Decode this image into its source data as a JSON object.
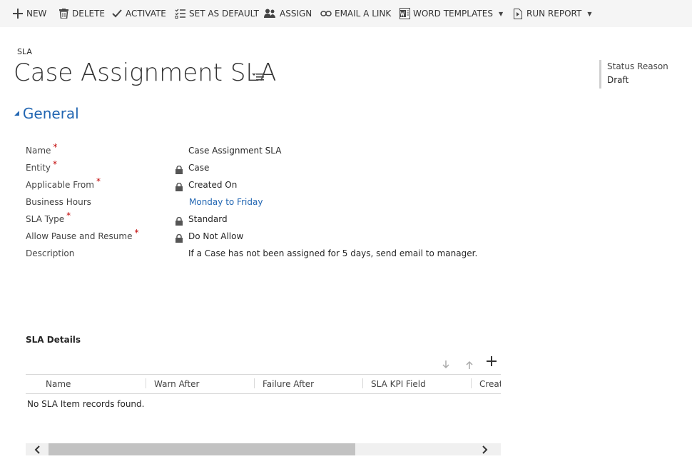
{
  "toolbar": {
    "new": "NEW",
    "delete": "DELETE",
    "activate": "ACTIVATE",
    "set_default": "SET AS DEFAULT",
    "assign": "ASSIGN",
    "email_link": "EMAIL A LINK",
    "word_templates": "WORD TEMPLATES",
    "run_report": "RUN REPORT"
  },
  "header": {
    "entity": "SLA",
    "title": "Case Assignment SLA"
  },
  "status": {
    "label": "Status Reason",
    "value": "Draft"
  },
  "section": {
    "title": "General"
  },
  "fields": {
    "name": {
      "label": "Name",
      "value": "Case Assignment SLA",
      "required": "*"
    },
    "entity": {
      "label": "Entity",
      "value": "Case",
      "required": "*"
    },
    "applicable_from": {
      "label": "Applicable From",
      "value": "Created On",
      "required": "*"
    },
    "business_hours": {
      "label": "Business Hours",
      "value": "Monday to Friday"
    },
    "sla_type": {
      "label": "SLA Type",
      "value": "Standard",
      "required": "*"
    },
    "allow_pause": {
      "label": "Allow Pause and Resume",
      "value": "Do Not Allow",
      "required": "*"
    },
    "description": {
      "label": "Description",
      "value": "If a Case has not been assigned for 5 days, send email to manager."
    }
  },
  "grid": {
    "title": "SLA Details",
    "columns": [
      "Name",
      "Warn After",
      "Failure After",
      "SLA KPI Field",
      "Created"
    ],
    "empty_message": "No SLA Item records found."
  },
  "colors": {
    "accent": "#2266b2",
    "required": "#c00000",
    "toolbar_bg": "#f5f5f5"
  }
}
